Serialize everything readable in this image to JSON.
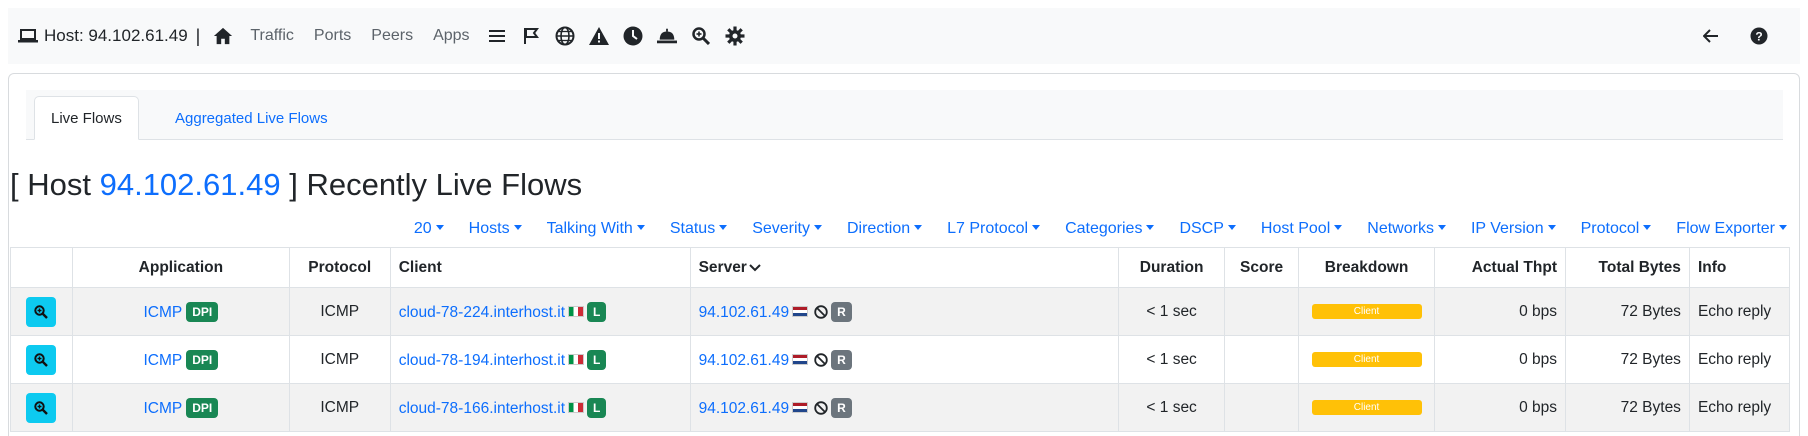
{
  "navbar": {
    "host_label": "Host: 94.102.61.49",
    "separator": "|",
    "links": [
      "Traffic",
      "Ports",
      "Peers",
      "Apps"
    ],
    "icons": [
      "home-icon",
      "list-icon",
      "flag-icon",
      "globe-icon",
      "warning-icon",
      "clock-icon",
      "bell-icon",
      "search-icon",
      "gear-icon"
    ],
    "right_icons": [
      "arrow-left-icon",
      "help-icon"
    ]
  },
  "tabs": [
    {
      "label": "Live Flows",
      "active": true
    },
    {
      "label": "Aggregated Live Flows",
      "active": false
    }
  ],
  "title": {
    "prefix": "[ Host ",
    "ip": "94.102.61.49",
    "suffix": " ] Recently Live Flows"
  },
  "filters": [
    "20",
    "Hosts",
    "Talking With",
    "Status",
    "Severity",
    "Direction",
    "L7 Protocol",
    "Categories",
    "DSCP",
    "Host Pool",
    "Networks",
    "IP Version",
    "Protocol",
    "Flow Exporter"
  ],
  "table": {
    "columns": [
      "",
      "Application",
      "Protocol",
      "Client",
      "Server",
      "Duration",
      "Score",
      "Breakdown",
      "Actual Thpt",
      "Total Bytes",
      "Info"
    ],
    "rows": [
      {
        "app": "ICMP",
        "app_badge": "DPI",
        "protocol": "ICMP",
        "client": "cloud-78-224.interhost.it",
        "client_badge": "L",
        "server": "94.102.61.49",
        "server_badge": "R",
        "duration": "< 1 sec",
        "score": "",
        "breakdown": "Client",
        "thpt": "0 bps",
        "bytes": "72 Bytes",
        "info": "Echo reply"
      },
      {
        "app": "ICMP",
        "app_badge": "DPI",
        "protocol": "ICMP",
        "client": "cloud-78-194.interhost.it",
        "client_badge": "L",
        "server": "94.102.61.49",
        "server_badge": "R",
        "duration": "< 1 sec",
        "score": "",
        "breakdown": "Client",
        "thpt": "0 bps",
        "bytes": "72 Bytes",
        "info": "Echo reply"
      },
      {
        "app": "ICMP",
        "app_badge": "DPI",
        "protocol": "ICMP",
        "client": "cloud-78-166.interhost.it",
        "client_badge": "L",
        "server": "94.102.61.49",
        "server_badge": "R",
        "duration": "< 1 sec",
        "score": "",
        "breakdown": "Client",
        "thpt": "0 bps",
        "bytes": "72 Bytes",
        "info": "Echo reply"
      }
    ]
  },
  "colors": {
    "link": "#0d6efd",
    "badge_green": "#198754",
    "badge_gray": "#6c757d",
    "breakdown_bar": "#ffc107",
    "zoom_button": "#0dcaf0"
  }
}
